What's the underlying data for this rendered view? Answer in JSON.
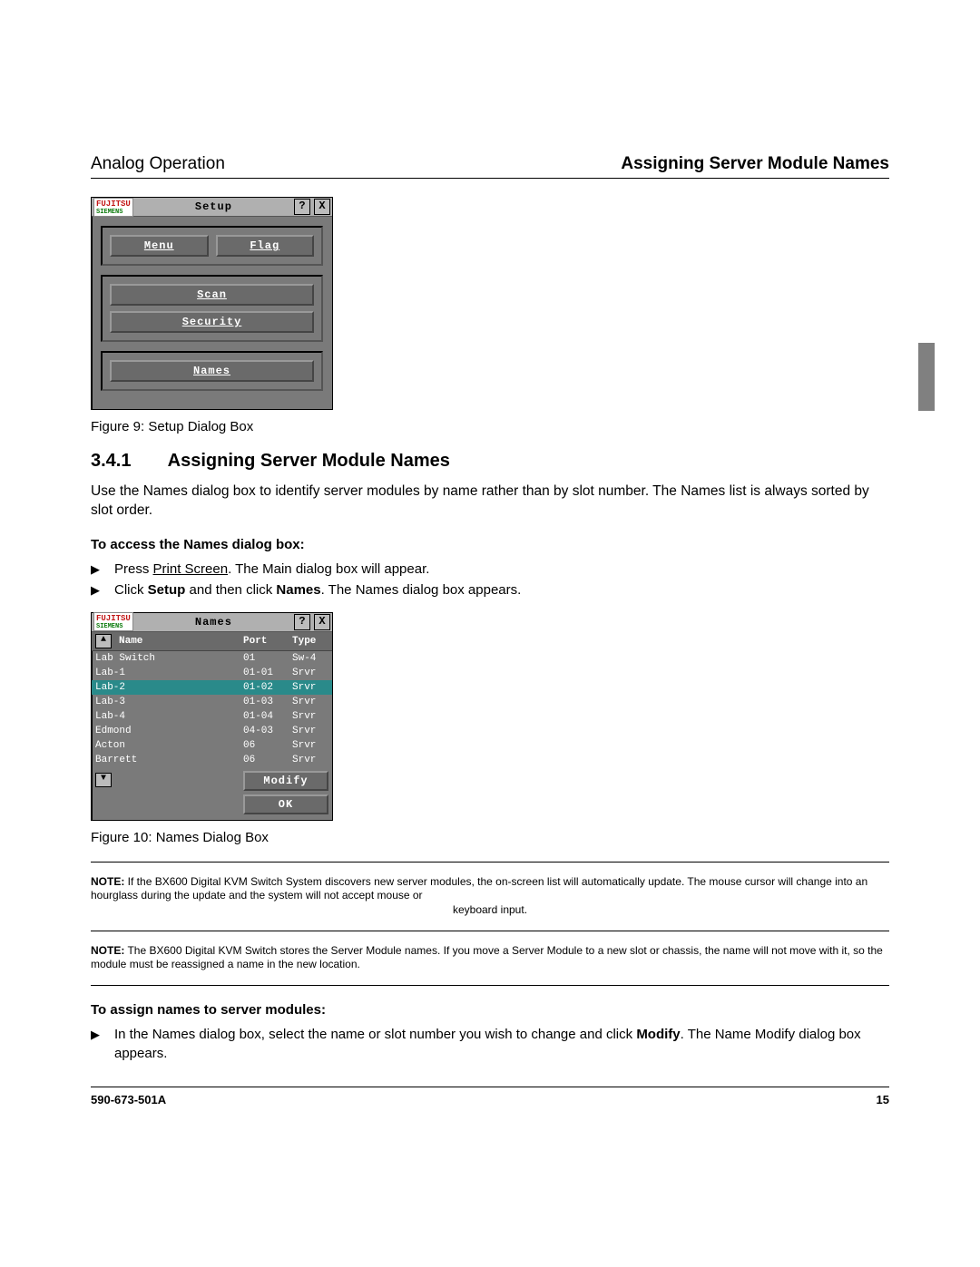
{
  "header": {
    "left": "Analog Operation",
    "right": "Assigning Server Module Names"
  },
  "setup_dialog": {
    "logo_top": "FUJITSU",
    "logo_bottom": "SIEMENS",
    "title": "Setup",
    "help_btn": "?",
    "close_btn": "X",
    "menu_btn": "Menu",
    "flag_btn": "Flag",
    "scan_btn": "Scan",
    "security_btn": "Security",
    "names_btn": "Names"
  },
  "fig9_caption": "Figure 9: Setup Dialog Box",
  "section": {
    "num": "3.4.1",
    "title": "Assigning Server Module Names"
  },
  "intro_para": "Use the Names dialog box to identify server modules by name rather than by slot number. The Names list is always sorted by slot order.",
  "subhead1": "To access the Names dialog box:",
  "bullets1": {
    "b1a": "Press ",
    "b1_link": "Print Screen",
    "b1b": ". The Main dialog box will appear.",
    "b2a": "Click ",
    "b2_bold1": "Setup",
    "b2b": " and then click ",
    "b2_bold2": "Names",
    "b2c": ". The Names dialog box appears."
  },
  "names_dialog": {
    "logo_top": "FUJITSU",
    "logo_bottom": "SIEMENS",
    "title": "Names",
    "help_btn": "?",
    "close_btn": "X",
    "col_name": "Name",
    "col_port": "Port",
    "col_type": "Type",
    "rows": [
      {
        "name": "Lab Switch",
        "port": "01",
        "type": "Sw-4",
        "sel": false
      },
      {
        "name": "Lab-1",
        "port": "01-01",
        "type": "Srvr",
        "sel": false
      },
      {
        "name": "Lab-2",
        "port": "01-02",
        "type": "Srvr",
        "sel": true
      },
      {
        "name": "Lab-3",
        "port": "01-03",
        "type": "Srvr",
        "sel": false
      },
      {
        "name": "Lab-4",
        "port": "01-04",
        "type": "Srvr",
        "sel": false
      },
      {
        "name": "Edmond",
        "port": "04-03",
        "type": "Srvr",
        "sel": false
      },
      {
        "name": "Acton",
        "port": "06",
        "type": "Srvr",
        "sel": false
      },
      {
        "name": "Barrett",
        "port": "06",
        "type": "Srvr",
        "sel": false
      }
    ],
    "modify_btn": "Modify",
    "ok_btn": "OK"
  },
  "fig10_caption": "Figure 10: Names Dialog Box",
  "note1": {
    "label": "NOTE:",
    "line1": " If the BX600 Digital KVM Switch System discovers new server modules, the on-screen list will automatically update. The mouse cursor will change into an hourglass during the update and the system will not accept mouse or",
    "center_line": "keyboard input."
  },
  "note2": {
    "label": "NOTE:",
    "text": " The BX600 Digital KVM Switch stores the Server Module names. If you move a Server Module to a new slot or chassis, the name will not move with it, so the module must be reassigned a name in the new location."
  },
  "subhead2": "To assign names to server modules:",
  "bullets2": {
    "b1a": "In the Names dialog box, select the name or slot number you wish to change and click ",
    "b1_bold": "Modify",
    "b1b": ". The Name Modify dialog box appears."
  },
  "footer": {
    "doc": "590-673-501A",
    "page": "15"
  },
  "icons": {
    "bullet": "▶",
    "up": "▲",
    "down": "▼"
  }
}
